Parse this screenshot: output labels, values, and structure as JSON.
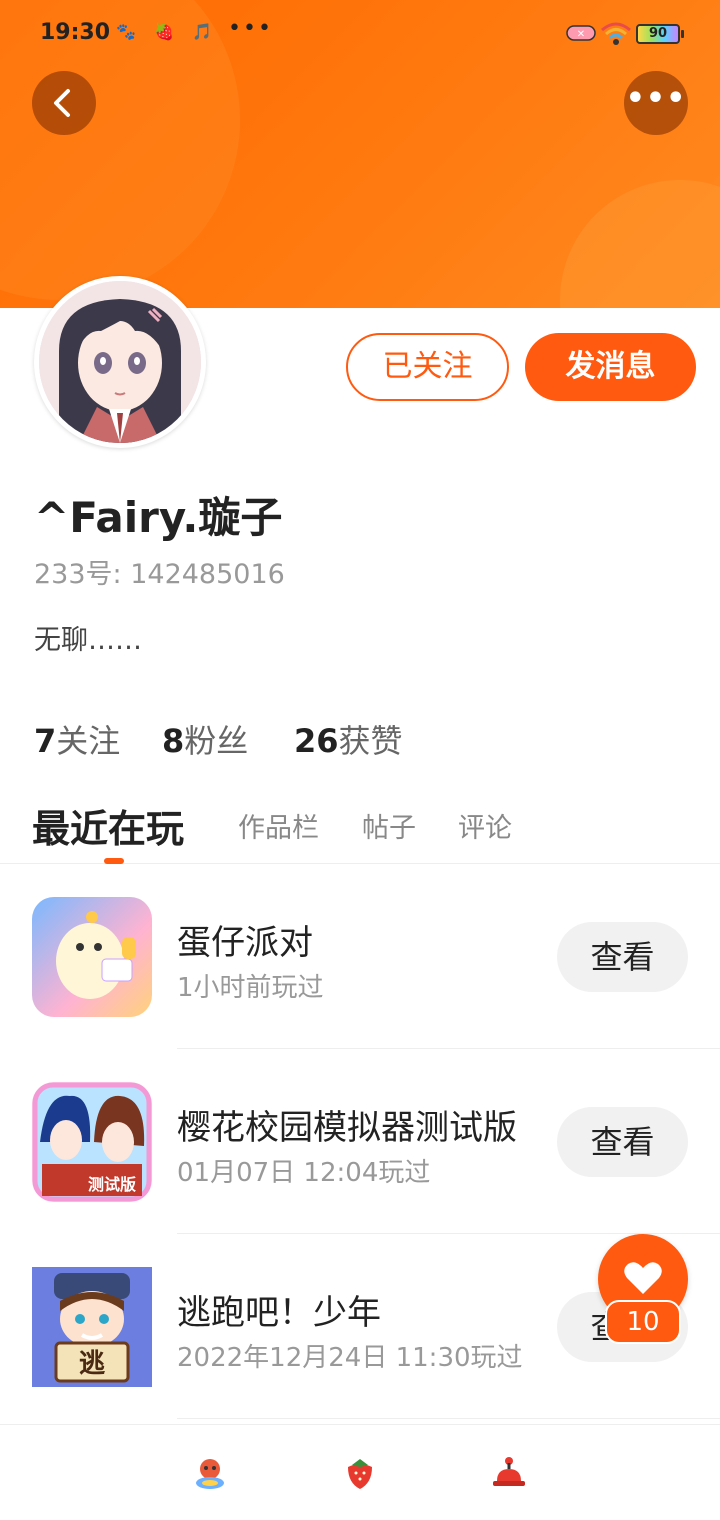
{
  "status_bar": {
    "time": "19:30",
    "overflow_dots": "•••",
    "battery": "90"
  },
  "header": {
    "back_icon": "chevron-left-icon",
    "more_icon": "more-horizontal-icon",
    "more_label": "•••",
    "accent_color": "#ff6a00"
  },
  "profile": {
    "follow_label": "已关注",
    "message_label": "发消息",
    "username": "^Fairy.璇子",
    "id_text": "233号: 142485016",
    "bio": "无聊……"
  },
  "stats": [
    {
      "num": "7",
      "label": "关注"
    },
    {
      "num": "8",
      "label": "粉丝"
    },
    {
      "num": "26",
      "label": "获赞"
    }
  ],
  "tabs": [
    "最近在玩",
    "作品栏",
    "帖子",
    "评论"
  ],
  "games": [
    {
      "title": "蛋仔派对",
      "played": "1小时前玩过",
      "button": "查看"
    },
    {
      "title": "樱花校园模拟器测试版",
      "played": "01月07日 12:04玩过",
      "button": "查看",
      "icon_text": "测试版"
    },
    {
      "title": "逃跑吧！少年",
      "played": "2022年12月24日 11:30玩过",
      "button": "查看",
      "icon_text": "逃"
    }
  ],
  "fab": {
    "icon": "heart-icon",
    "count": "10"
  },
  "bottom_nav": [
    "character-icon",
    "strawberry-icon",
    "hat-icon"
  ]
}
